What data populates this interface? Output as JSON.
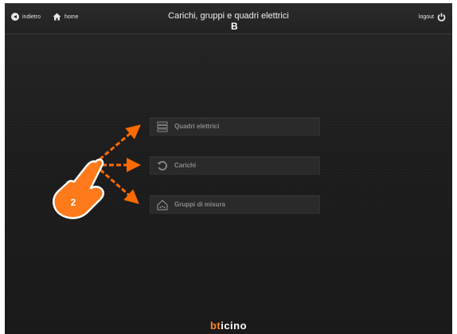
{
  "header": {
    "back_label": "indietro",
    "home_label": "home",
    "title": "Carichi, gruppi e quadri elettrici",
    "logout_label": "logout"
  },
  "annotation": {
    "marker_b": "B",
    "step_number": "2",
    "accent_color": "#ff6a00"
  },
  "menu": {
    "items": [
      {
        "label": "Quadri elettrici",
        "icon": "electrical-panel-icon"
      },
      {
        "label": "Carichi",
        "icon": "rotate-arrow-icon"
      },
      {
        "label": "Gruppi di misura",
        "icon": "house-meter-icon"
      }
    ]
  },
  "footer": {
    "brand_first": "bt",
    "brand_rest": "icino"
  }
}
